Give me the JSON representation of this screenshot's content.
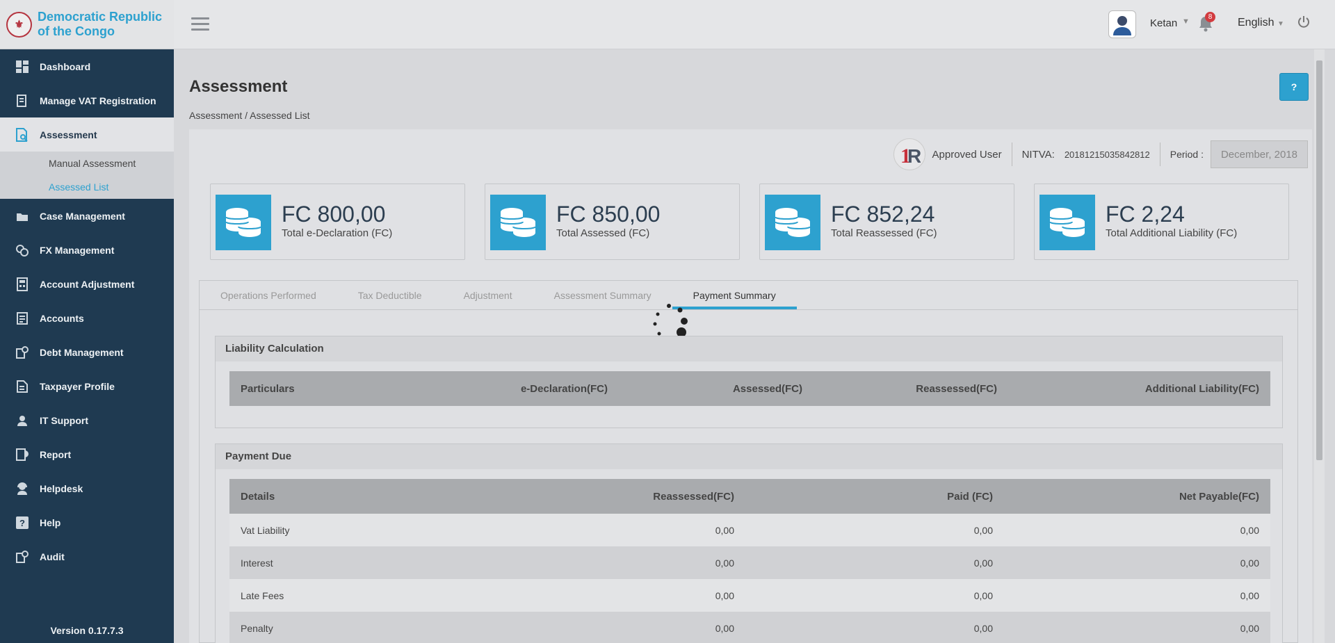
{
  "brand": {
    "name": "Democratic Republic of the Congo",
    "logo_icon": "coat-of-arms-icon"
  },
  "sidebar": {
    "items": [
      {
        "label": "Dashboard",
        "icon": "dashboard-icon"
      },
      {
        "label": "Manage VAT Registration",
        "icon": "registration-icon"
      },
      {
        "label": "Assessment",
        "icon": "assessment-icon"
      },
      {
        "label": "Case Management",
        "icon": "case-icon"
      },
      {
        "label": "FX Management",
        "icon": "fx-icon"
      },
      {
        "label": "Account Adjustment",
        "icon": "adjustment-icon"
      },
      {
        "label": "Accounts",
        "icon": "accounts-icon"
      },
      {
        "label": "Debt Management",
        "icon": "debt-icon"
      },
      {
        "label": "Taxpayer Profile",
        "icon": "profile-icon"
      },
      {
        "label": "IT Support",
        "icon": "support-icon"
      },
      {
        "label": "Report",
        "icon": "report-icon"
      },
      {
        "label": "Helpdesk",
        "icon": "helpdesk-icon"
      },
      {
        "label": "Help",
        "icon": "help-icon"
      },
      {
        "label": "Audit",
        "icon": "audit-icon"
      }
    ],
    "submenu": [
      {
        "label": "Manual Assessment"
      },
      {
        "label": "Assessed List"
      }
    ],
    "version": "Version 0.17.7.3"
  },
  "header": {
    "user": "Ketan",
    "notification_count": "8",
    "language": "English"
  },
  "page": {
    "title": "Assessment",
    "breadcrumb": "Assessment / Assessed List",
    "help_label": "?"
  },
  "info": {
    "user_status": "Approved User",
    "nitva_label": "NITVA:",
    "nitva_value": "20181215035842812",
    "period_label": "Period :",
    "period_value": "December, 2018"
  },
  "cards": [
    {
      "value": "FC 800,00",
      "label": "Total e-Declaration (FC)"
    },
    {
      "value": "FC 850,00",
      "label": "Total Assessed (FC)"
    },
    {
      "value": "FC 852,24",
      "label": "Total Reassessed (FC)"
    },
    {
      "value": "FC 2,24",
      "label": "Total Additional Liability (FC)"
    }
  ],
  "tabs": [
    {
      "label": "Operations Performed"
    },
    {
      "label": "Tax Deductible"
    },
    {
      "label": "Adjustment"
    },
    {
      "label": "Assessment Summary"
    },
    {
      "label": "Payment Summary"
    }
  ],
  "liability": {
    "title": "Liability Calculation",
    "headers": [
      "Particulars",
      "e-Declaration(FC)",
      "Assessed(FC)",
      "Reassessed(FC)",
      "Additional Liability(FC)"
    ]
  },
  "payment_due": {
    "title": "Payment Due",
    "headers": [
      "Details",
      "Reassessed(FC)",
      "Paid (FC)",
      "Net Payable(FC)"
    ],
    "rows": [
      {
        "detail": "Vat Liability",
        "reassessed": "0,00",
        "paid": "0,00",
        "net": "0,00"
      },
      {
        "detail": "Interest",
        "reassessed": "0,00",
        "paid": "0,00",
        "net": "0,00"
      },
      {
        "detail": "Late Fees",
        "reassessed": "0,00",
        "paid": "0,00",
        "net": "0,00"
      },
      {
        "detail": "Penalty",
        "reassessed": "0,00",
        "paid": "0,00",
        "net": "0,00"
      }
    ]
  },
  "colors": {
    "accent": "#2da1cf",
    "sidebar": "#1f3a51",
    "badge": "#d23b3f"
  }
}
